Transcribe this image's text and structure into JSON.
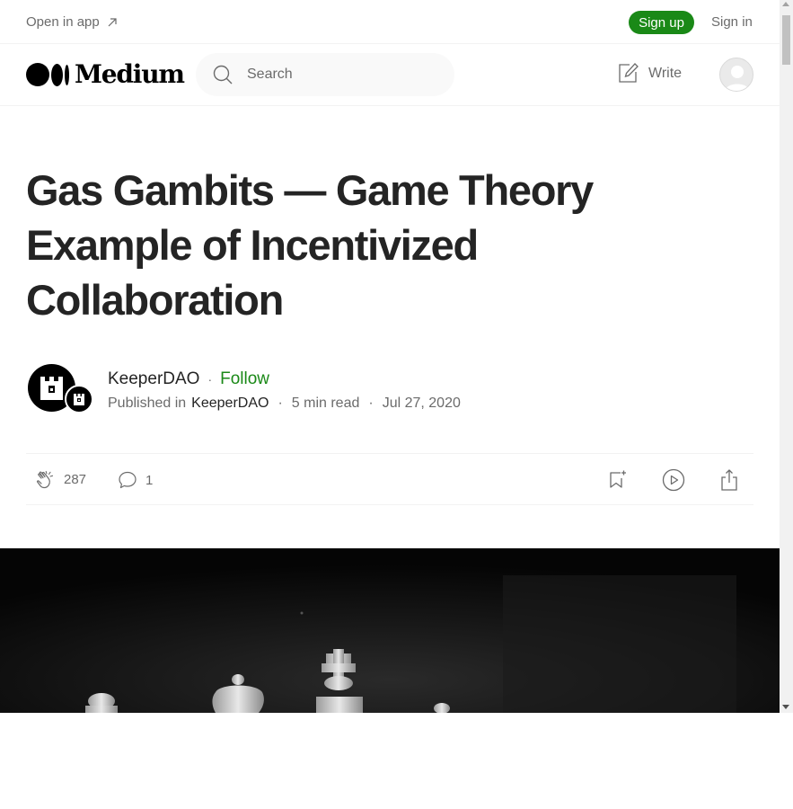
{
  "topbar": {
    "open_in_app": "Open in app",
    "signup_label": "Sign up",
    "signin_label": "Sign in"
  },
  "navbar": {
    "logo_text": "Medium",
    "search_placeholder": "Search",
    "write_label": "Write"
  },
  "article": {
    "title_lines": [
      "Gas Gambits — Game Theory",
      "Example of Incentivized",
      "Collaboration"
    ],
    "author": "KeeperDAO",
    "follow_label": "Follow",
    "published_in_prefix": "Published in",
    "publication": "KeeperDAO",
    "read_time": "5 min read",
    "date": "Jul 27, 2020"
  },
  "actions": {
    "claps": "287",
    "responses": "1"
  },
  "colors": {
    "accent_green": "#1a8917",
    "text_primary": "#242424",
    "text_secondary": "#6b6b6b"
  },
  "icons": {
    "external": "arrow-up-right-icon",
    "search": "search-icon",
    "write": "pencil-square-icon",
    "clap": "clap-hands-icon",
    "response": "speech-bubble-icon",
    "bookmark": "bookmark-add-icon",
    "listen": "play-circle-icon",
    "share": "share-icon"
  }
}
